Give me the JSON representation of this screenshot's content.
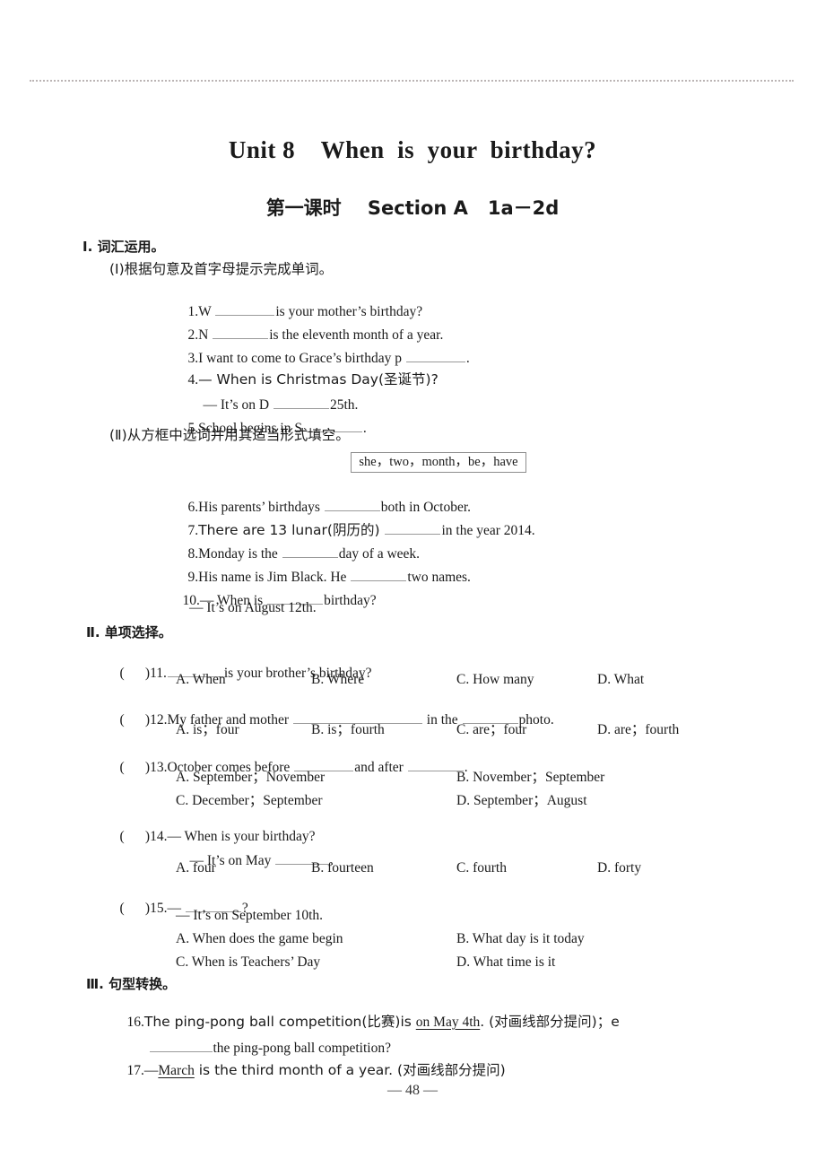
{
  "page": {
    "number": "— 48 —"
  },
  "header": {
    "unit_title": "Unit 8    When  is  your  birthday?",
    "lesson_title": "第一课时    Section A   1a－2d"
  },
  "sections": [
    {
      "id": "I",
      "heading": "Ⅰ. 词汇运用。",
      "subsections": [
        {
          "id": "I-1",
          "heading": "(Ⅰ)根据句意及首字母提示完成单词。",
          "items": [
            {
              "num": "1.",
              "pre": "W ",
              "post": "is your mother’s birthday?"
            },
            {
              "num": "2.",
              "pre": "N ",
              "post": "is the eleventh month of a year."
            },
            {
              "num": "3.",
              "pre": "I want to come to Grace’s birthday p ",
              "post": "."
            },
            {
              "num": "4.",
              "pre": "— When is Christmas Day(圣诞节)?",
              "post": ""
            },
            {
              "num": "",
              "pre": "— It’s on D ",
              "post": "25th."
            },
            {
              "num": "5.",
              "pre": "School begins in S ",
              "post": "."
            }
          ]
        },
        {
          "id": "I-2",
          "heading": "(Ⅱ)从方框中选词并用其适当形式填空。",
          "wordbank": "she，two，month，be，have",
          "items": [
            {
              "num": "6.",
              "pre": "His parents’ birthdays ",
              "post": "both in October."
            },
            {
              "num": "7.",
              "pre": "There are 13 lunar(阴历的) ",
              "post": "in the year 2014."
            },
            {
              "num": "8.",
              "pre": "Monday is the ",
              "post": "day of a week."
            },
            {
              "num": "9.",
              "pre": "His name is Jim Black. He ",
              "post": "two names."
            },
            {
              "num": "10.",
              "pre": "— When is ",
              "post": "birthday?"
            },
            {
              "num": "",
              "pre": "— It’s on August 12th.",
              "post": ""
            }
          ]
        }
      ]
    },
    {
      "id": "II",
      "heading": "Ⅱ. 单项选择。",
      "questions": [
        {
          "paren": "(      )11.",
          "stem_pre": "",
          "stem_post": "is your brother’s birthday?",
          "options": [
            "A. When",
            "B. Where",
            "C. How many",
            "D. What"
          ],
          "layout": "row4"
        },
        {
          "paren": "(      )12.",
          "stem_pre": "My father and mother ",
          "stem_mid": " in the ",
          "stem_post": "photo.",
          "options": [
            "A. is；four",
            "B. is；fourth",
            "C. are；four",
            "D. are；fourth"
          ],
          "layout": "row4"
        },
        {
          "paren": "(      )13.",
          "stem_pre": "October comes before ",
          "stem_mid": "and after ",
          "stem_post": ".",
          "options": [
            "A. September；November",
            "B. November；September",
            "C. December；September",
            "D. September；August"
          ],
          "layout": "grid2"
        },
        {
          "paren": "(      )14.",
          "stem_line1": "— When is your birthday?",
          "stem_line2_pre": "— It’s on May ",
          "stem_line2_post": ".",
          "options": [
            "A. four",
            "B. fourteen",
            "C. fourth",
            "D. forty"
          ],
          "layout": "row4"
        },
        {
          "paren": "(      )15.",
          "stem_line1_pre": "— ",
          "stem_line1_post": "?",
          "stem_line2": "— It’s on September 10th.",
          "options": [
            "A. When does the game begin",
            "B. What day is it today",
            "C. When is Teachers’ Day",
            "D. What time is it"
          ],
          "layout": "grid2"
        }
      ]
    },
    {
      "id": "III",
      "heading": "Ⅲ. 句型转换。",
      "items": [
        {
          "num": "16.",
          "line1_a": "The ping-pong ball competition(比赛)is ",
          "line1_mark": "on May 4th",
          "line1_b": ". (对画线部分提问)；e",
          "line2_post": "the ping-pong ball competition?"
        },
        {
          "num": "17.",
          "line1_a": "—",
          "line1_mark": "March",
          "line1_b": " is the third month of a year. (对画线部分提问)"
        }
      ]
    }
  ]
}
